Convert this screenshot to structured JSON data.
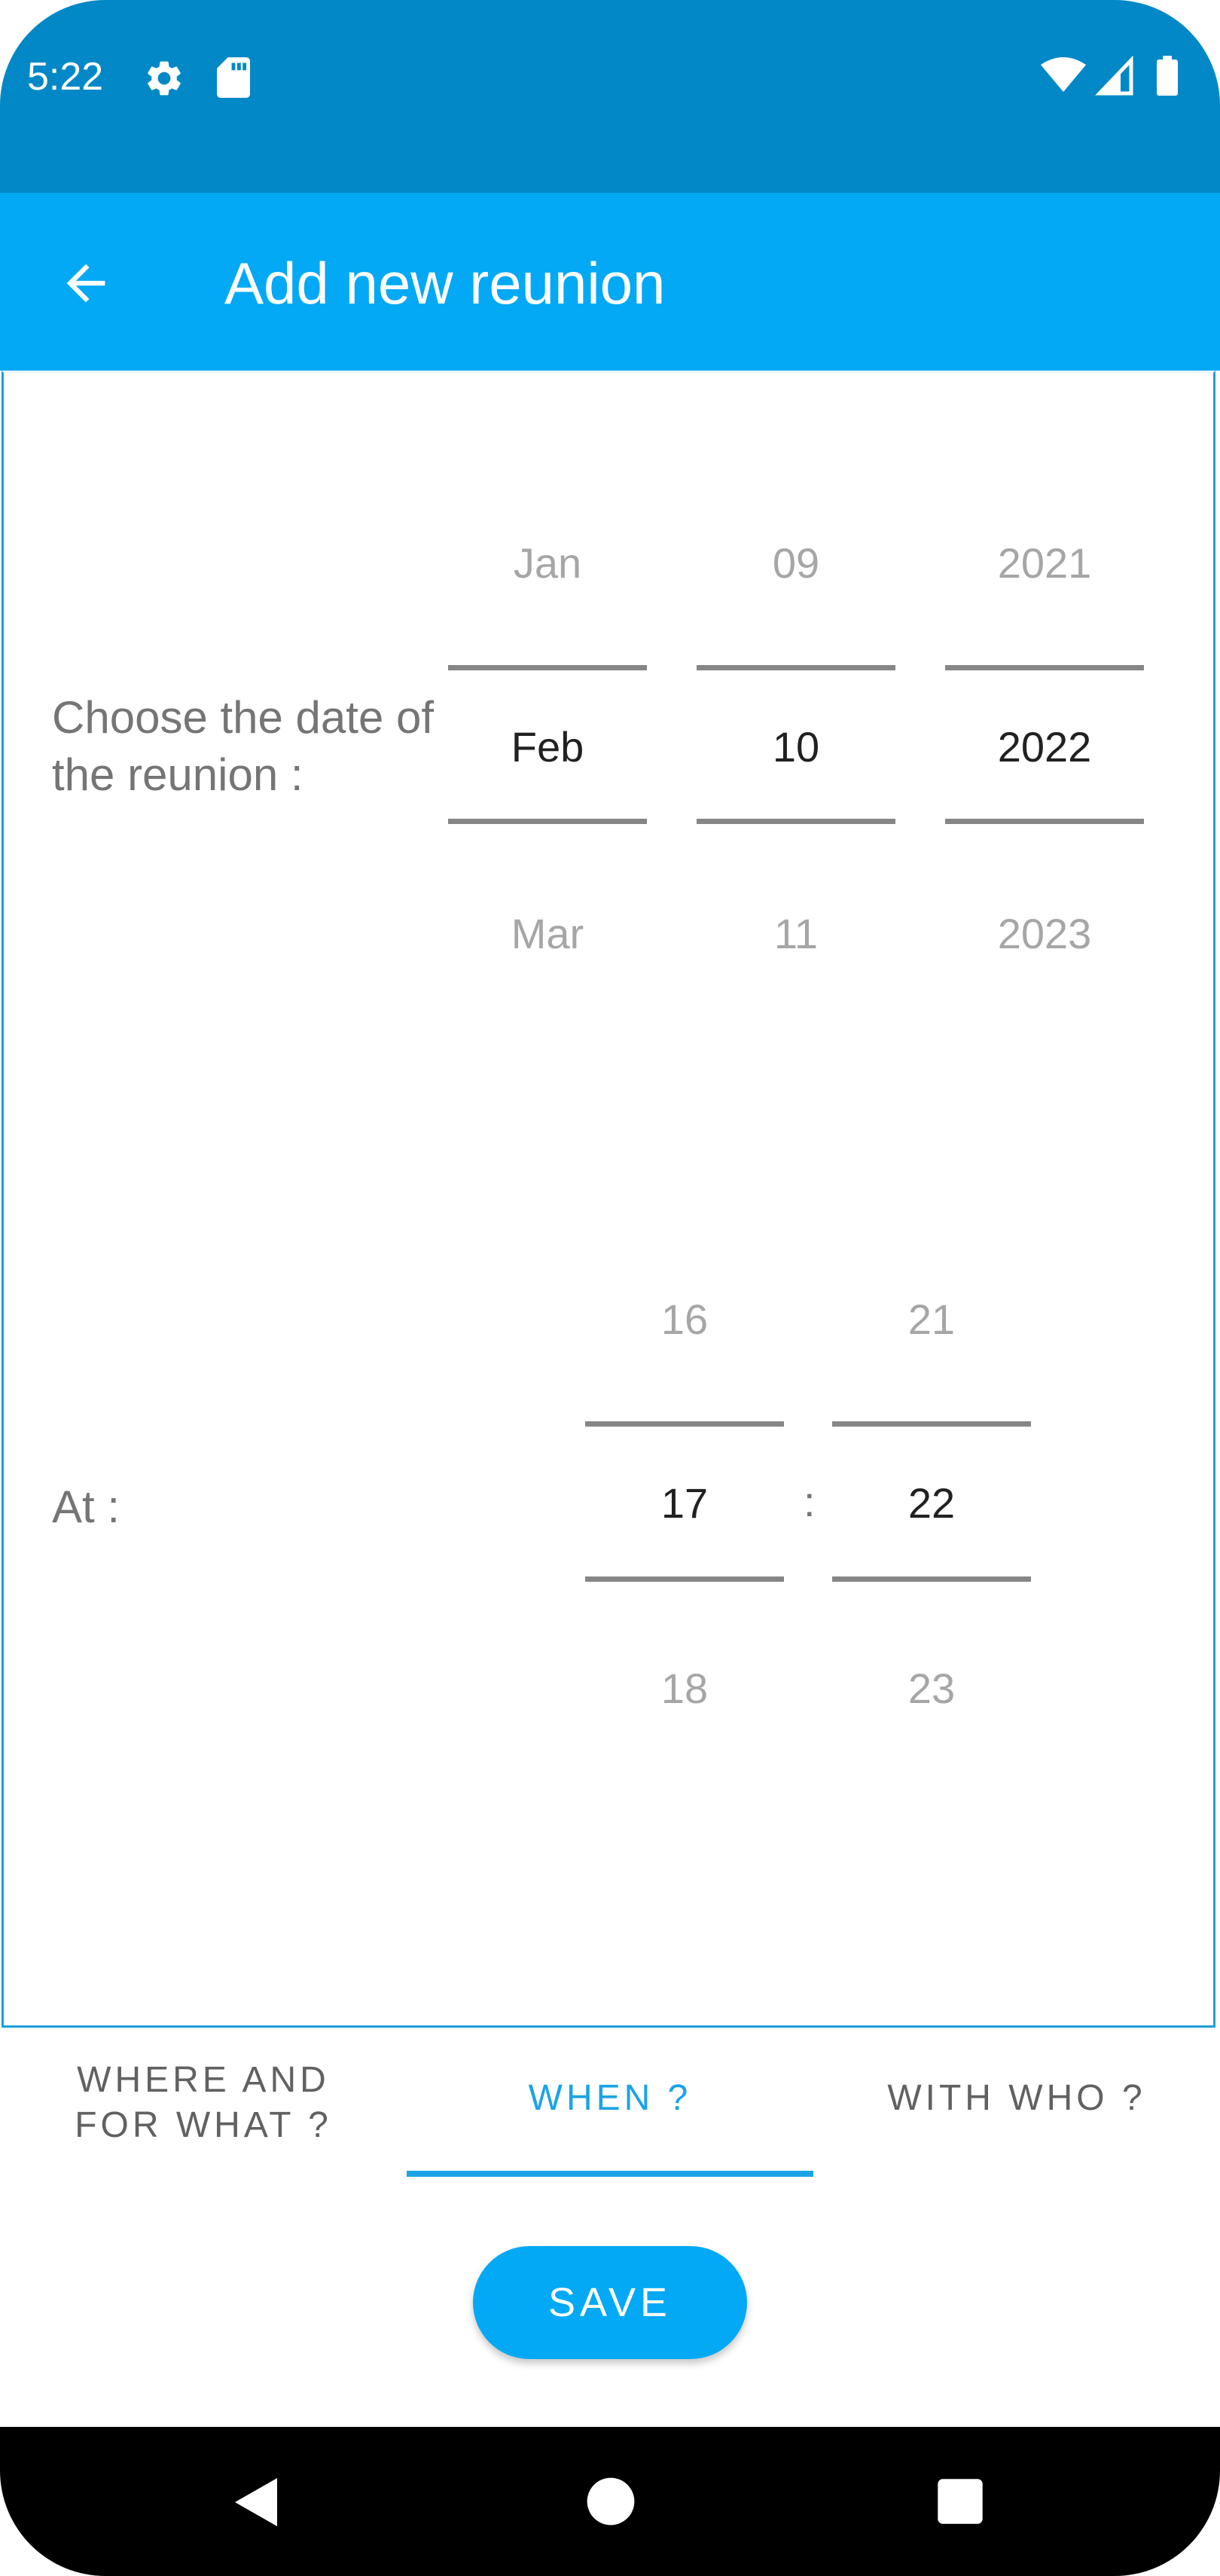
{
  "status_bar": {
    "time": "5:22",
    "icons": [
      "gear-icon",
      "sd-card-icon",
      "wifi-icon",
      "signal-icon",
      "battery-icon"
    ]
  },
  "app_bar": {
    "title": "Add new reunion",
    "back_icon": "arrow-left-icon"
  },
  "date_section": {
    "label": "Choose the date of the reunion :",
    "month": {
      "prev": "Jan",
      "selected": "Feb",
      "next": "Mar"
    },
    "day": {
      "prev": "09",
      "selected": "10",
      "next": "11"
    },
    "year": {
      "prev": "2021",
      "selected": "2022",
      "next": "2023"
    }
  },
  "time_section": {
    "label": "At :",
    "separator": ":",
    "hour": {
      "prev": "16",
      "selected": "17",
      "next": "18"
    },
    "minute": {
      "prev": "21",
      "selected": "22",
      "next": "23"
    }
  },
  "tabs": [
    {
      "label": "WHERE AND FOR WHAT ?",
      "active": false
    },
    {
      "label": "WHEN ?",
      "active": true
    },
    {
      "label": "WITH WHO ?",
      "active": false
    }
  ],
  "save_button": {
    "label": "SAVE"
  },
  "colors": {
    "status_bar": "#0288c6",
    "app_bar": "#03a9f4",
    "accent": "#1ba3e6"
  }
}
